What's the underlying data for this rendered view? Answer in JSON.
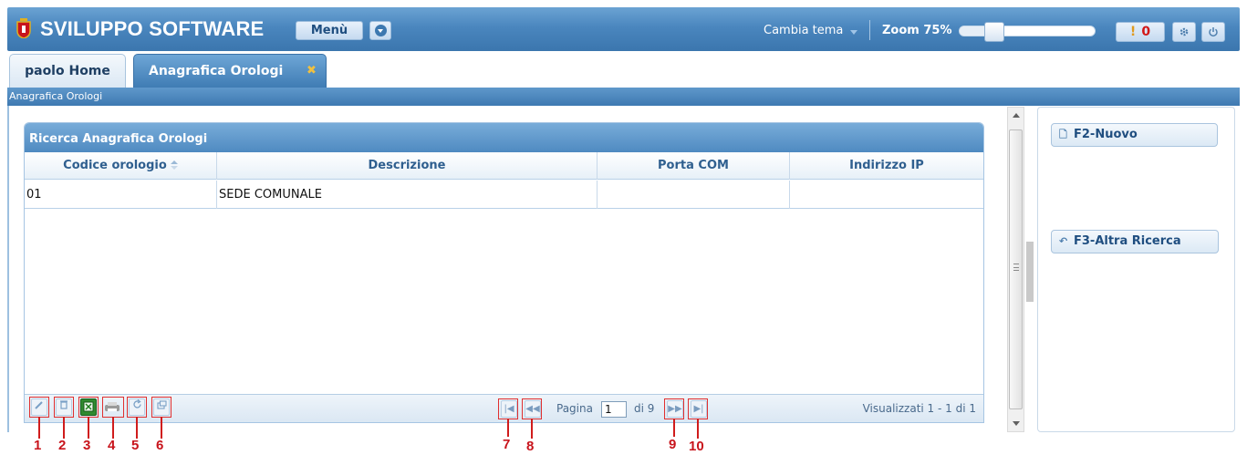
{
  "app": {
    "title": "SVILUPPO SOFTWARE",
    "menu_label": "Menù",
    "theme_label": "Cambia tema",
    "zoom_label": "Zoom 75%",
    "zoom_value": 0.26,
    "notification_icon": "!",
    "notification_count": "0",
    "settings_icon": "gear-icon",
    "power_icon": "power-icon"
  },
  "tabs": [
    {
      "label": "paolo Home",
      "active": false
    },
    {
      "label": "Anagrafica Orologi",
      "active": true,
      "close_label": "✖"
    }
  ],
  "breadcrumb": "Anagrafica Orologi",
  "grid": {
    "caption": "Ricerca Anagrafica Orologi",
    "columns": [
      "Codice orologio",
      "Descrizione",
      "Porta COM",
      "Indirizzo IP"
    ],
    "rows": [
      [
        "01",
        "SEDE COMUNALE",
        "",
        ""
      ]
    ],
    "pager": {
      "page_label": "Pagina",
      "page_value": "1",
      "of_label": "di 9",
      "info": "Visualizzati 1 - 1 di 1"
    }
  },
  "side": {
    "new_label": "F2-Nuovo",
    "search_label": "F3-Altra Ricerca"
  },
  "annotations": [
    "1",
    "2",
    "3",
    "4",
    "5",
    "6",
    "7",
    "8",
    "9",
    "10"
  ],
  "colors": {
    "header_blue": "#4a86be",
    "accent_red": "#c8141c",
    "notification_red": "#d21818"
  }
}
